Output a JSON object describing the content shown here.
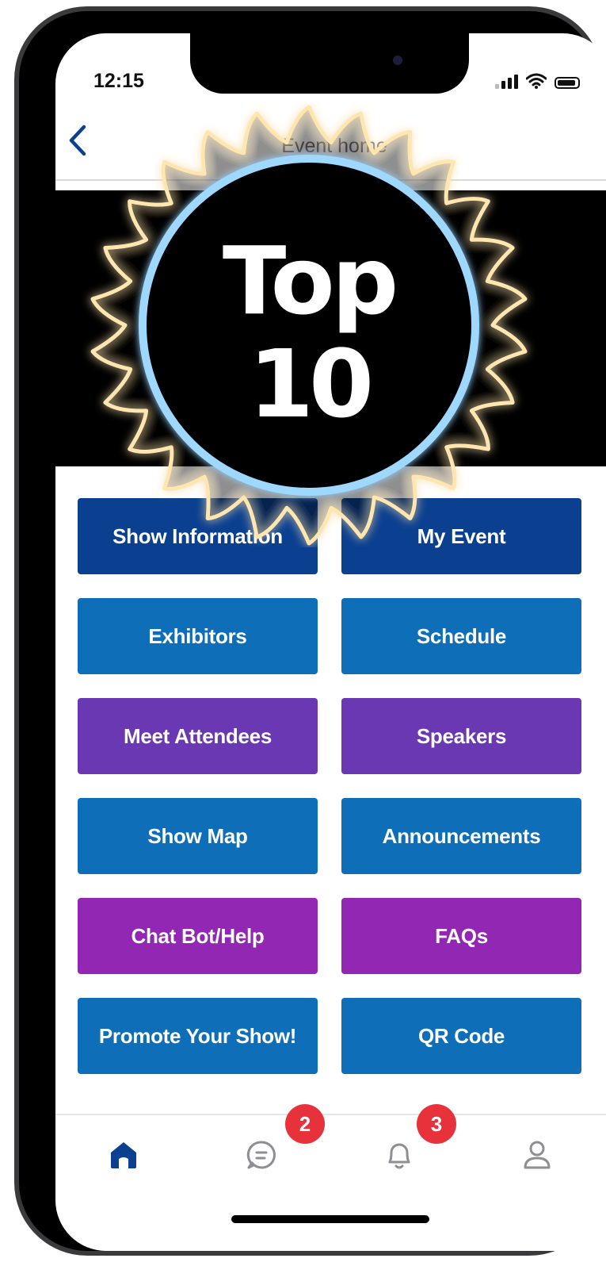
{
  "status_bar": {
    "time": "12:15"
  },
  "header": {
    "title": "Event home"
  },
  "overlay": {
    "line1": "Top",
    "line2": "10"
  },
  "tiles": [
    {
      "label": "Show Information",
      "color": "#0b3f8f"
    },
    {
      "label": "My Event",
      "color": "#0b3f8f"
    },
    {
      "label": "Exhibitors",
      "color": "#0e6fb8"
    },
    {
      "label": "Schedule",
      "color": "#0e6fb8"
    },
    {
      "label": "Meet Attendees",
      "color": "#6a38b3"
    },
    {
      "label": "Speakers",
      "color": "#6a38b3"
    },
    {
      "label": "Show Map",
      "color": "#0e6fb8"
    },
    {
      "label": "Announcements",
      "color": "#0e6fb8"
    },
    {
      "label": "Chat Bot/Help",
      "color": "#9127b3"
    },
    {
      "label": "FAQs",
      "color": "#9127b3"
    },
    {
      "label": "Promote Your Show!",
      "color": "#0e6fb8"
    },
    {
      "label": "QR Code",
      "color": "#0e6fb8"
    }
  ],
  "tabbar": {
    "tabs": [
      {
        "name": "home",
        "active": true
      },
      {
        "name": "messages",
        "badge": "2"
      },
      {
        "name": "notifications",
        "badge": "3"
      },
      {
        "name": "profile"
      }
    ]
  },
  "colors": {
    "accent": "#0b3f8f",
    "badge": "#e8323b"
  }
}
